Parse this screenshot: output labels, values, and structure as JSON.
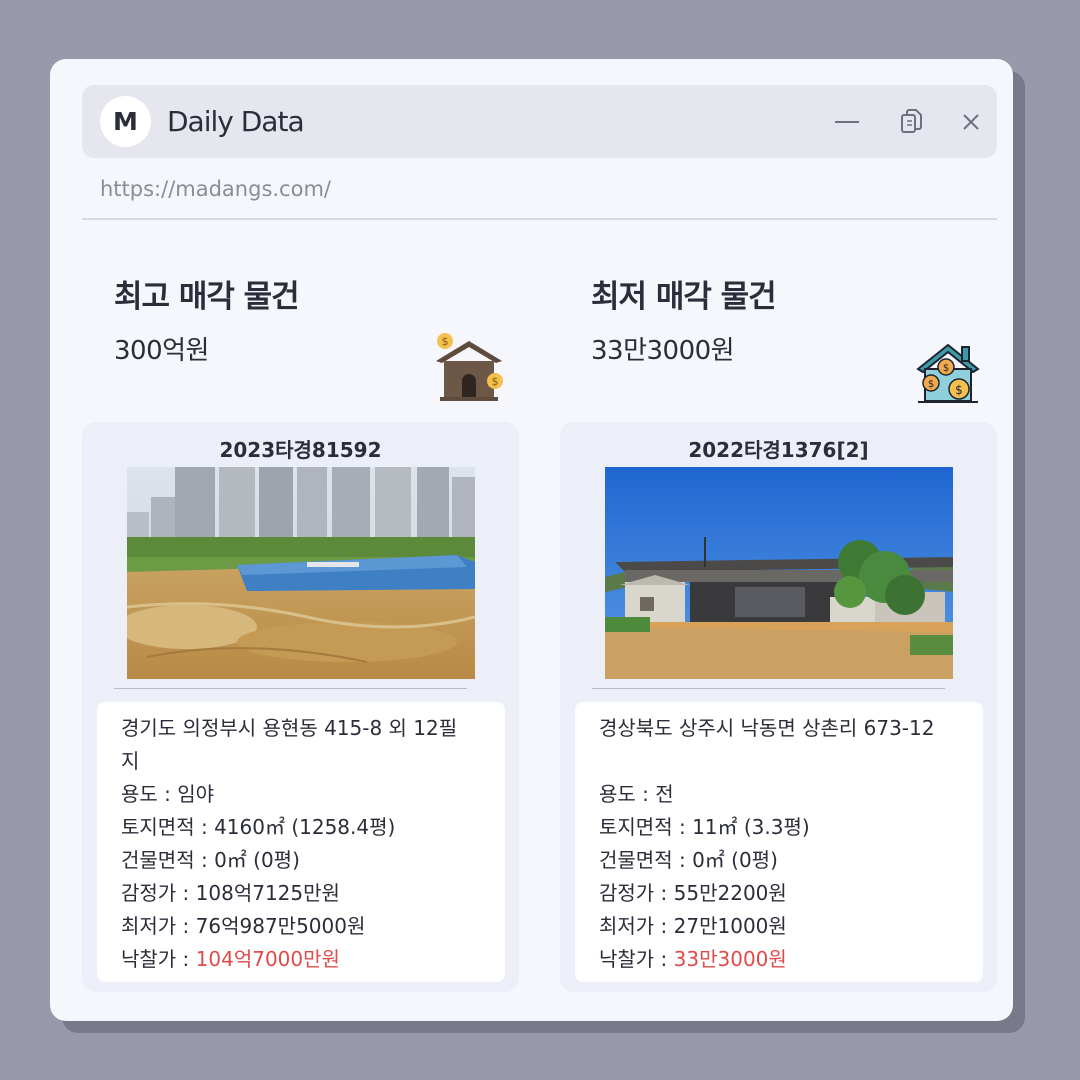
{
  "window": {
    "logo_letter": "M",
    "title": "Daily Data",
    "url": "https://madangs.com/"
  },
  "highest": {
    "title": "최고 매각 물건",
    "value": "300억원",
    "icon": "house-money-icon",
    "case_no": "2023타경81592",
    "address": "경기도 의정부시 용현동 415-8 외 12필지",
    "usage_label": "용도 : ",
    "usage": "임야",
    "land_label": "토지면적 : ",
    "land": "4160㎡ (1258.4평)",
    "building_label": "건물면적 : ",
    "building": "0㎡ (0평)",
    "appraisal_label": "감정가 : ",
    "appraisal": "108억7125만원",
    "minimum_label": "최저가 : ",
    "minimum": "76억987만5000원",
    "winning_label": "낙찰가 : ",
    "winning": "104억7000만원"
  },
  "lowest": {
    "title": "최저 매각 물건",
    "value": "33만3000원",
    "icon": "house-coins-icon",
    "case_no": "2022타경1376[2]",
    "address": "경상북도 상주시 낙동면 상촌리 673-12",
    "usage_label": "용도 : ",
    "usage": "전",
    "land_label": "토지면적 : ",
    "land": "11㎡ (3.3평)",
    "building_label": "건물면적 : ",
    "building": "0㎡ (0평)",
    "appraisal_label": "감정가 : ",
    "appraisal": "55만2200원",
    "minimum_label": "최저가 : ",
    "minimum": "27만1000원",
    "winning_label": "낙찰가 : ",
    "winning": "33만3000원"
  },
  "colors": {
    "background": "#989aac",
    "window": "#f6f7fc",
    "titlebar": "#e5e6ee",
    "card": "#eceef8",
    "price_highlight": "#e24a4a"
  }
}
